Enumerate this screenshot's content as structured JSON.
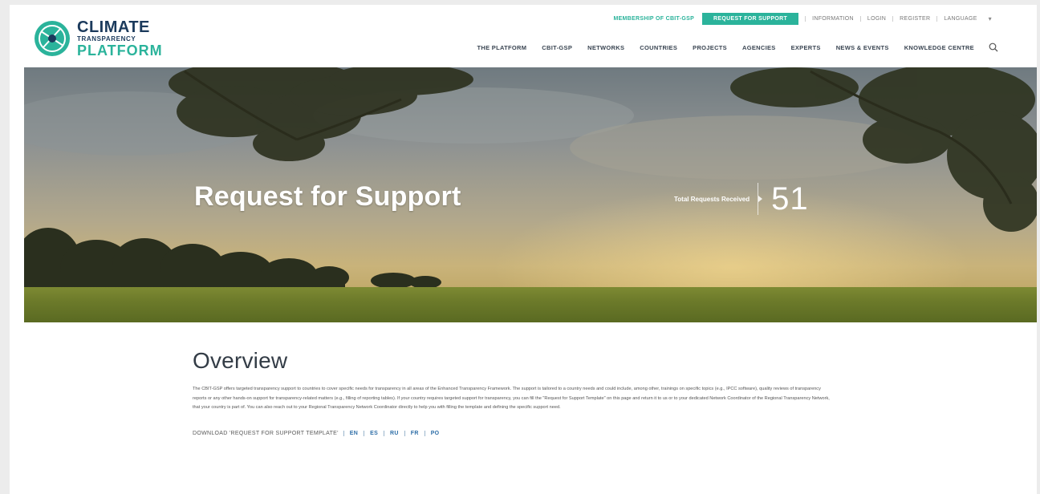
{
  "header": {
    "logo": {
      "line1": "CLIMATE",
      "line2": "TRANSPARENCY",
      "line3": "PLATFORM",
      "icon": "globe-logo-icon"
    },
    "utility": {
      "green_link": "MEMBERSHIP OF CBIT-GSP",
      "button_label": "REQUEST FOR SUPPORT",
      "links": [
        "INFORMATION",
        "LOGIN",
        "REGISTER",
        "LANGUAGE"
      ],
      "caret_icon": "chevron-down-icon"
    },
    "nav": {
      "items": [
        "THE PLATFORM",
        "CBIT-GSP",
        "NETWORKS",
        "COUNTRIES",
        "PROJECTS",
        "AGENCIES",
        "EXPERTS",
        "NEWS & EVENTS",
        "KNOWLEDGE CENTRE"
      ],
      "search_icon": "search-icon"
    }
  },
  "hero": {
    "title": "Request for Support",
    "stat_label": "Total Requests Received",
    "stat_value": "51"
  },
  "overview": {
    "title": "Overview",
    "body": "The CBIT-GSP offers targeted transparency support to countries to cover specific needs for transparency in all areas of the Enhanced Transparency Framework. The support is tailored to a country needs and could include, among other, trainings on specific topics (e.g., IPCC software), quality reviews of transparency reports or any other hands-on support for transparency-related matters (e.g., filling of reporting tables). If your country requires targeted support for transparency, you can fill the \"Request for Support Template\" on this page and return it to us or to your dedicated Network Coordinator of the Regional Transparency Network, that your country is part of. You can also reach out to your Regional Transparency Network Coordinator directly to help you with filling the template and defining the specific support need.",
    "download_label": "DOWNLOAD 'REQUEST FOR SUPPORT TEMPLATE'",
    "languages": [
      "EN",
      "ES",
      "RU",
      "FR",
      "PO"
    ]
  },
  "colors": {
    "brand_navy": "#1b3a5c",
    "brand_teal": "#2bb39b",
    "link_blue": "#2f6fa8"
  }
}
